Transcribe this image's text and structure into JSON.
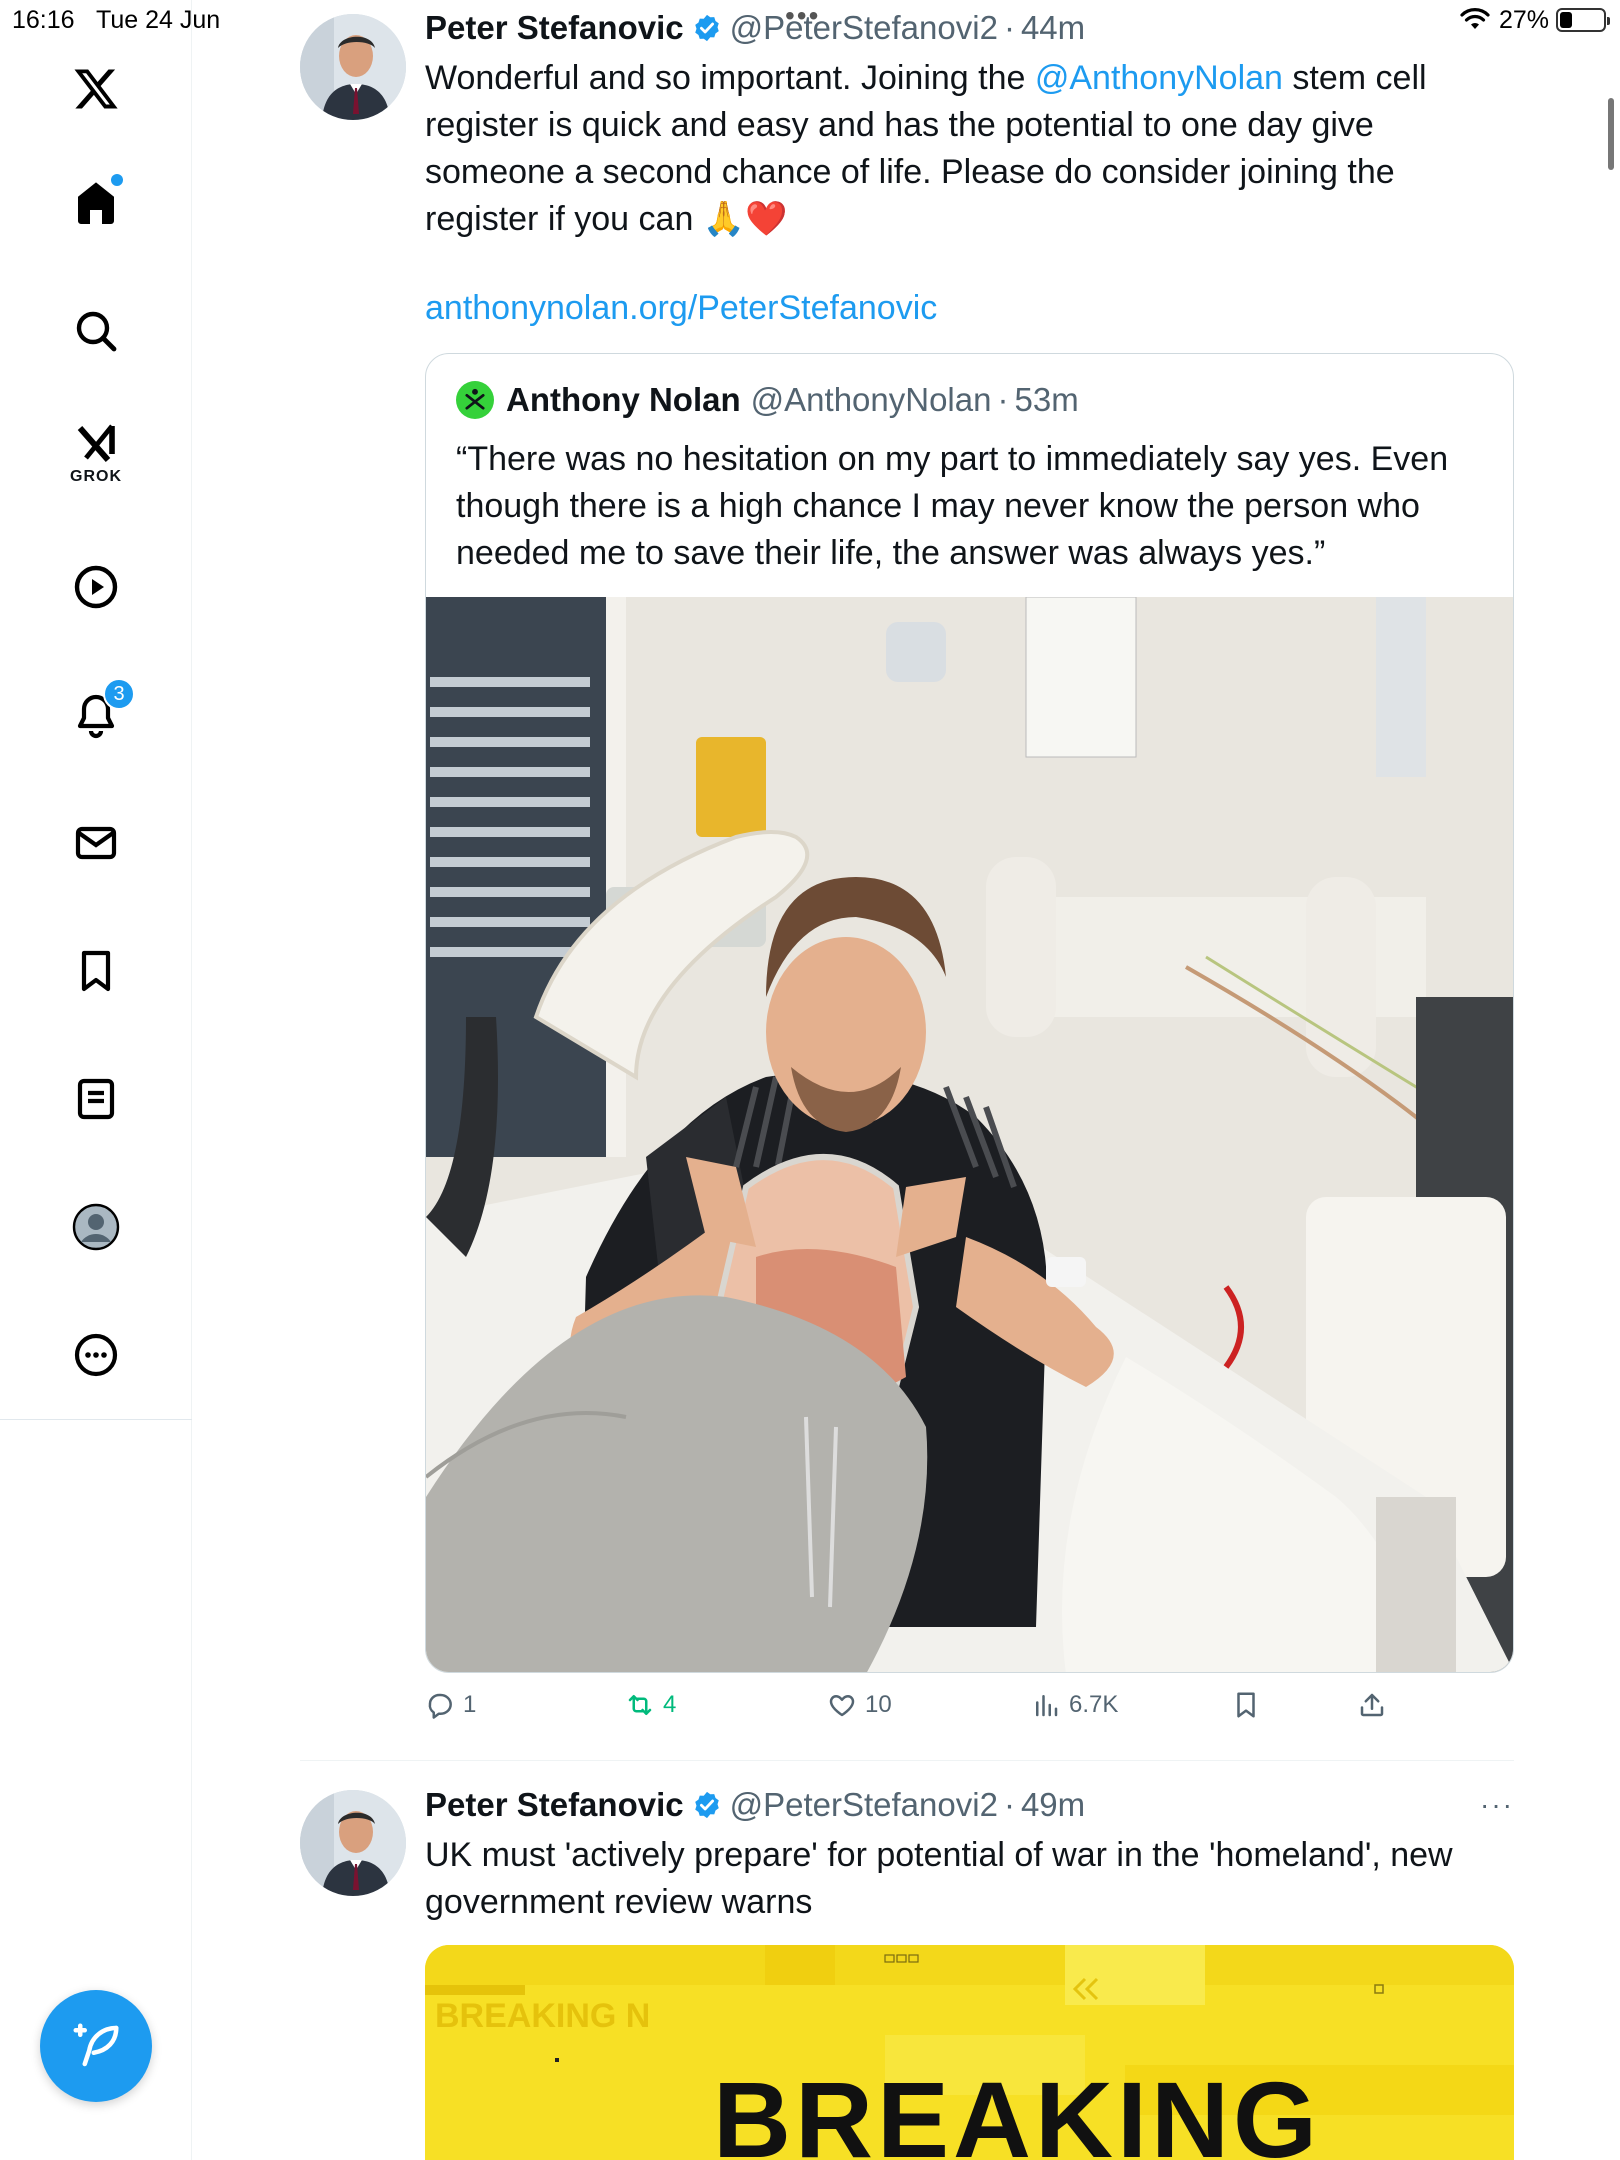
{
  "status_bar": {
    "time": "16:16",
    "date": "Tue 24 Jun",
    "battery": "27%"
  },
  "sidebar": {
    "items": [
      {
        "name": "x-logo-icon"
      },
      {
        "name": "home-icon"
      },
      {
        "name": "search-icon"
      },
      {
        "name": "grok-icon",
        "label": "GROK"
      },
      {
        "name": "video-play-icon"
      },
      {
        "name": "notifications-icon",
        "badge": "3"
      },
      {
        "name": "messages-icon"
      },
      {
        "name": "bookmarks-icon"
      },
      {
        "name": "lists-icon"
      },
      {
        "name": "profile-icon"
      },
      {
        "name": "more-icon"
      }
    ],
    "compose_icon": "compose-feather-icon"
  },
  "tweets": [
    {
      "name": "Peter Stefanovic",
      "handle": "@PeterStefanovi2",
      "separator": "·",
      "time": "44m",
      "text_before": "Wonderful and so important. Joining the ",
      "mention": "@AnthonyNolan",
      "text_after": " stem cell register is quick and easy and has the potential to one day give someone a second chance of life. Please do consider joining the register if you can 🙏❤️",
      "link": "anthonynolan.org/PeterStefanovic",
      "quote": {
        "name": "Anthony Nolan",
        "handle": "@AnthonyNolan",
        "separator": "·",
        "time": "53m",
        "text": "“There was no hesitation on my part to immediately say yes. Even though there is a high chance I may never know the person who needed me to save their life, the answer was always yes.”"
      },
      "stats": {
        "replies": "1",
        "reposts": "4",
        "likes": "10",
        "views": "6.7K"
      }
    },
    {
      "name": "Peter Stefanovic",
      "handle": "@PeterStefanovi2",
      "separator": "·",
      "time": "49m",
      "more": "···",
      "text": "UK must 'actively prepare' for potential of war in the 'homeland', new government review warns",
      "image_text": "BREAKING",
      "image_faded_text": "BREAKING N"
    }
  ],
  "colors": {
    "accent": "#1d9bf0",
    "repost_green": "#00ba7c",
    "secondary_text": "#536471",
    "breaking_yellow": "#f7e025"
  }
}
